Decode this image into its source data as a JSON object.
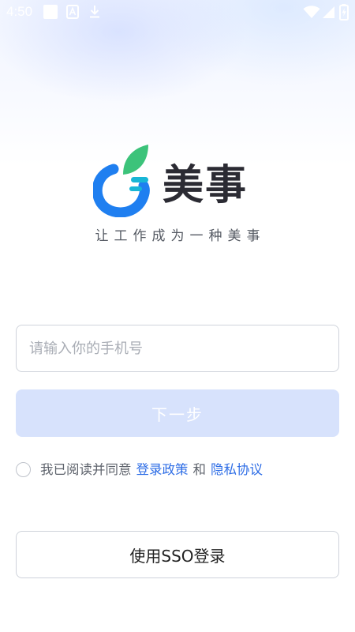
{
  "status_bar": {
    "time": "4:50",
    "icons": [
      "notification-square-icon",
      "app-a-icon",
      "download-icon",
      "wifi-icon",
      "signal-icon",
      "battery-icon"
    ]
  },
  "brand": {
    "name": "美事",
    "slogan": "让工作成为一种美事",
    "colors": {
      "logo_blue": "#1f7ff0",
      "logo_green": "#3cc37a",
      "logo_teal": "#18b6d6"
    }
  },
  "login": {
    "phone_placeholder": "请输入你的手机号",
    "phone_value": "",
    "next_label": "下一步",
    "agreement": {
      "prefix": "我已阅读并同意",
      "link_policy": "登录政策",
      "conjunction": "和",
      "link_privacy": "隐私协议",
      "checked": false
    },
    "sso_label": "使用SSO登录"
  },
  "colors": {
    "accent": "#2f6ee6",
    "next_button_disabled": "#d7e2fc",
    "border": "#cfd3db"
  }
}
